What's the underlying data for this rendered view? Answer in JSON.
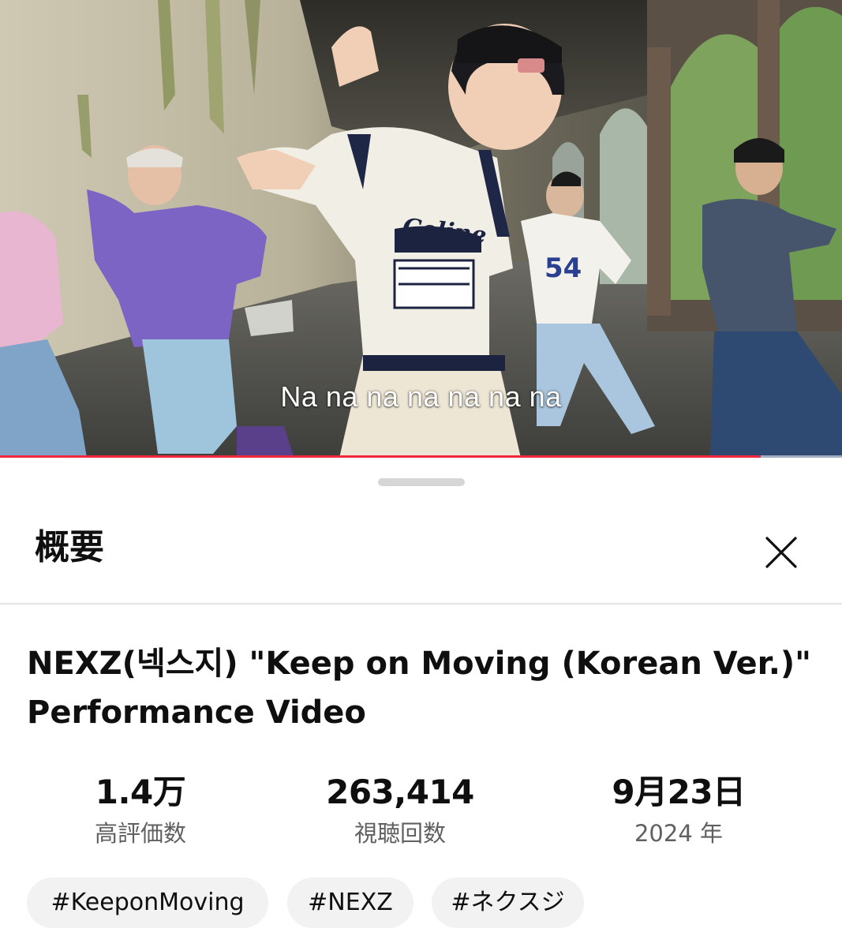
{
  "video": {
    "subtitle": "Na na na na na na na",
    "progress_fraction": 0.903,
    "progress_color": "#f0283c",
    "shirt_print": "Celine",
    "jersey_number": "54"
  },
  "sheet": {
    "title": "概要",
    "close_icon": "close-icon"
  },
  "description": {
    "video_title": "NEXZ(넥스지) \"Keep on Moving (Korean Ver.)\" Performance Video",
    "stats": [
      {
        "value": "1.4万",
        "label": "高評価数"
      },
      {
        "value": "263,414",
        "label": "視聴回数"
      },
      {
        "value": "9月23日",
        "label": "2024 年"
      }
    ],
    "hashtags": [
      "#KeeponMoving",
      "#NEXZ",
      "#ネクスジ"
    ]
  }
}
